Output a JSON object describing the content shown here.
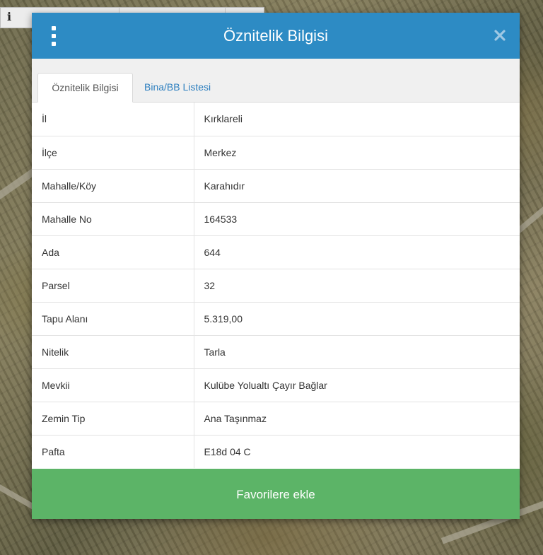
{
  "map": {
    "info_glyph": "i"
  },
  "dialog": {
    "title": "Öznitelik Bilgisi",
    "menu_icon": "kebab-menu-icon",
    "close_icon": "close-icon",
    "tabs": [
      {
        "label": "Öznitelik Bilgisi",
        "active": true
      },
      {
        "label": "Bina/BB Listesi",
        "active": false
      }
    ],
    "attributes": [
      {
        "key": "İl",
        "value": "Kırklareli"
      },
      {
        "key": "İlçe",
        "value": "Merkez"
      },
      {
        "key": "Mahalle/Köy",
        "value": "Karahıdır"
      },
      {
        "key": "Mahalle No",
        "value": "164533"
      },
      {
        "key": "Ada",
        "value": "644"
      },
      {
        "key": "Parsel",
        "value": "32"
      },
      {
        "key": "Tapu Alanı",
        "value": "5.319,00"
      },
      {
        "key": "Nitelik",
        "value": "Tarla"
      },
      {
        "key": "Mevkii",
        "value": "Kulübe Yolualtı Çayır Bağlar"
      },
      {
        "key": "Zemin Tip",
        "value": "Ana Taşınmaz"
      },
      {
        "key": "Pafta",
        "value": "E18d 04 C"
      }
    ],
    "favorite_button": "Favorilere ekle"
  },
  "colors": {
    "header": "#2d8bc4",
    "tab_link": "#2d7fbf",
    "favorite": "#5cb467"
  }
}
